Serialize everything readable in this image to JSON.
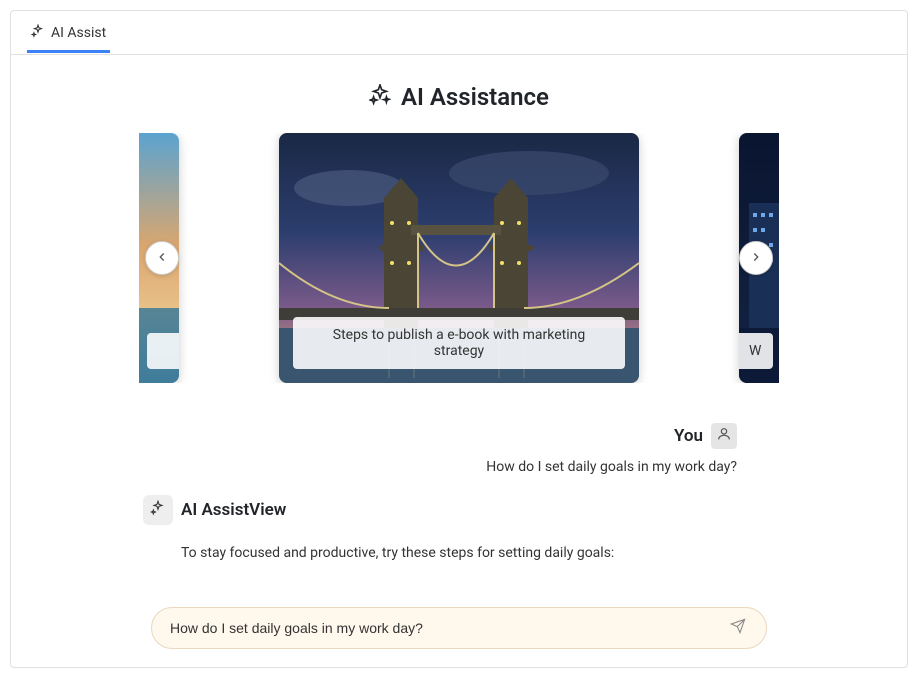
{
  "tab": {
    "label": "AI Assist"
  },
  "header": {
    "title": "AI Assistance"
  },
  "carousel": {
    "center_caption": "Steps to publish a e-book with marketing strategy",
    "right_caption_partial": "W"
  },
  "messages": {
    "user": {
      "name": "You",
      "text": "How do I set daily goals in my work day?"
    },
    "assistant": {
      "name": "AI AssistView",
      "text": "To stay focused and productive, try these steps for setting daily goals:"
    }
  },
  "input": {
    "value": "How do I set daily goals in my work day?"
  }
}
